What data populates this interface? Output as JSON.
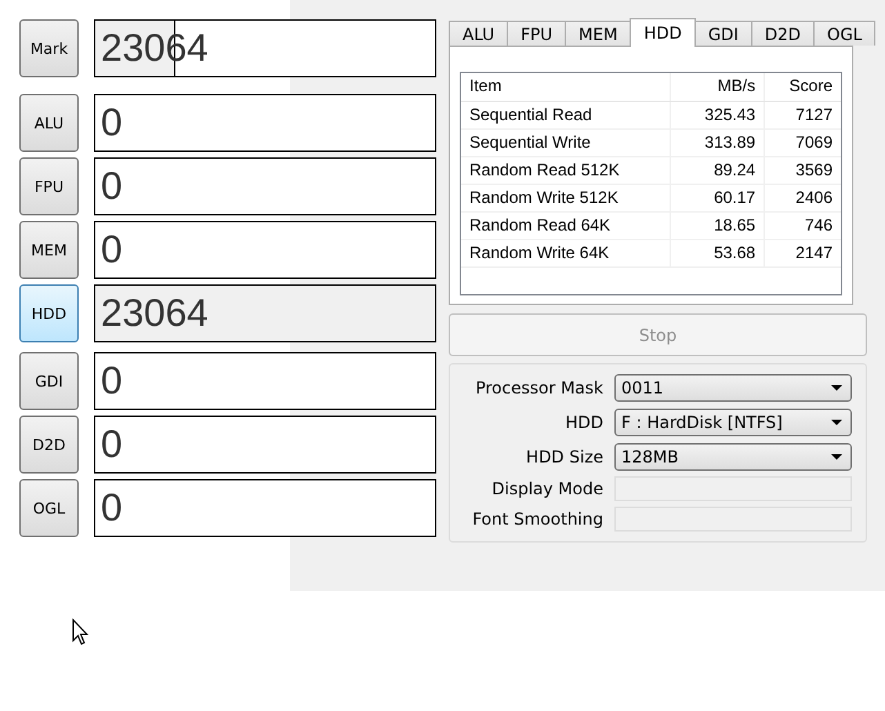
{
  "mark": {
    "label": "Mark",
    "score": "23064",
    "level": 0.23
  },
  "tests": [
    {
      "label": "ALU",
      "score": "0",
      "selected": false
    },
    {
      "label": "FPU",
      "score": "0",
      "selected": false
    },
    {
      "label": "MEM",
      "score": "0",
      "selected": false
    },
    {
      "label": "HDD",
      "score": "23064",
      "selected": true
    },
    {
      "label": "GDI",
      "score": "0",
      "selected": false
    },
    {
      "label": "D2D",
      "score": "0",
      "selected": false
    },
    {
      "label": "OGL",
      "score": "0",
      "selected": false
    }
  ],
  "tabs": [
    {
      "label": "ALU",
      "selected": false
    },
    {
      "label": "FPU",
      "selected": false
    },
    {
      "label": "MEM",
      "selected": false
    },
    {
      "label": "HDD",
      "selected": true
    },
    {
      "label": "GDI",
      "selected": false
    },
    {
      "label": "D2D",
      "selected": false
    },
    {
      "label": "OGL",
      "selected": false
    }
  ],
  "table": {
    "columns": [
      "Item",
      "MB/s",
      "Score"
    ],
    "rows": [
      [
        "Sequential Read",
        "325.43",
        "7127"
      ],
      [
        "Sequential Write",
        "313.89",
        "7069"
      ],
      [
        "Random Read 512K",
        "89.24",
        "3569"
      ],
      [
        "Random Write 512K",
        "60.17",
        "2406"
      ],
      [
        "Random Read 64K",
        "18.65",
        "746"
      ],
      [
        "Random Write 64K",
        "53.68",
        "2147"
      ]
    ]
  },
  "stop_button": {
    "label": "Stop",
    "disabled": true
  },
  "settings": [
    {
      "label": "Processor Mask",
      "kind": "dropdown",
      "value": "0011"
    },
    {
      "label": "HDD",
      "kind": "dropdown",
      "value": "F : HardDisk [NTFS]"
    },
    {
      "label": "HDD Size",
      "kind": "dropdown",
      "value": "128MB"
    },
    {
      "label": "Display Mode",
      "kind": "empty"
    },
    {
      "label": "Font Smoothing",
      "kind": "empty"
    }
  ]
}
